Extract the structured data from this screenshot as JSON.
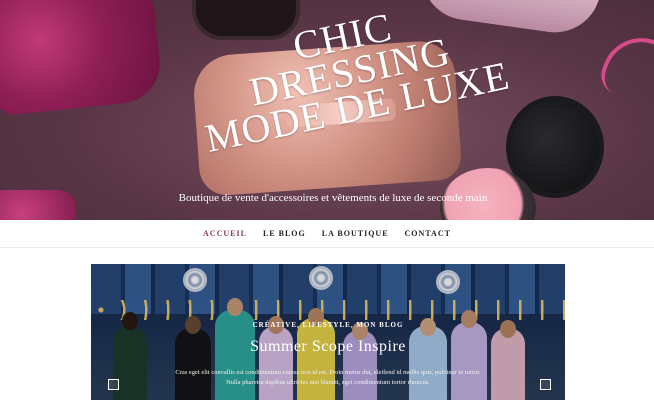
{
  "site": {
    "title_lines": [
      "CHIC",
      "DRESSING",
      "MODE DE LUXE"
    ],
    "tagline": "Boutique de vente d'accessoires et vêtements de luxe de seconde main"
  },
  "nav": {
    "items": [
      {
        "label": "ACCUEIL",
        "active": true
      },
      {
        "label": "LE BLOG",
        "active": false
      },
      {
        "label": "LA BOUTIQUE",
        "active": false
      },
      {
        "label": "CONTACT",
        "active": false
      }
    ]
  },
  "featured_post": {
    "categories": "CRÉATIVE, LIFESTYLE, MON BLOG",
    "title": "Summer Scope Inspire",
    "excerpt": "Cras eget elit convallis est condimentum cursus non id est. Proin metus dui, eleifend id mollis quis, pulvinar in tortor. Nulla pharetra dapibus ultricies nisi blandit, eget condimentum tortor rhoncus."
  },
  "colors": {
    "accent": "#8a3a55",
    "hero_bg": "#5a3646"
  }
}
